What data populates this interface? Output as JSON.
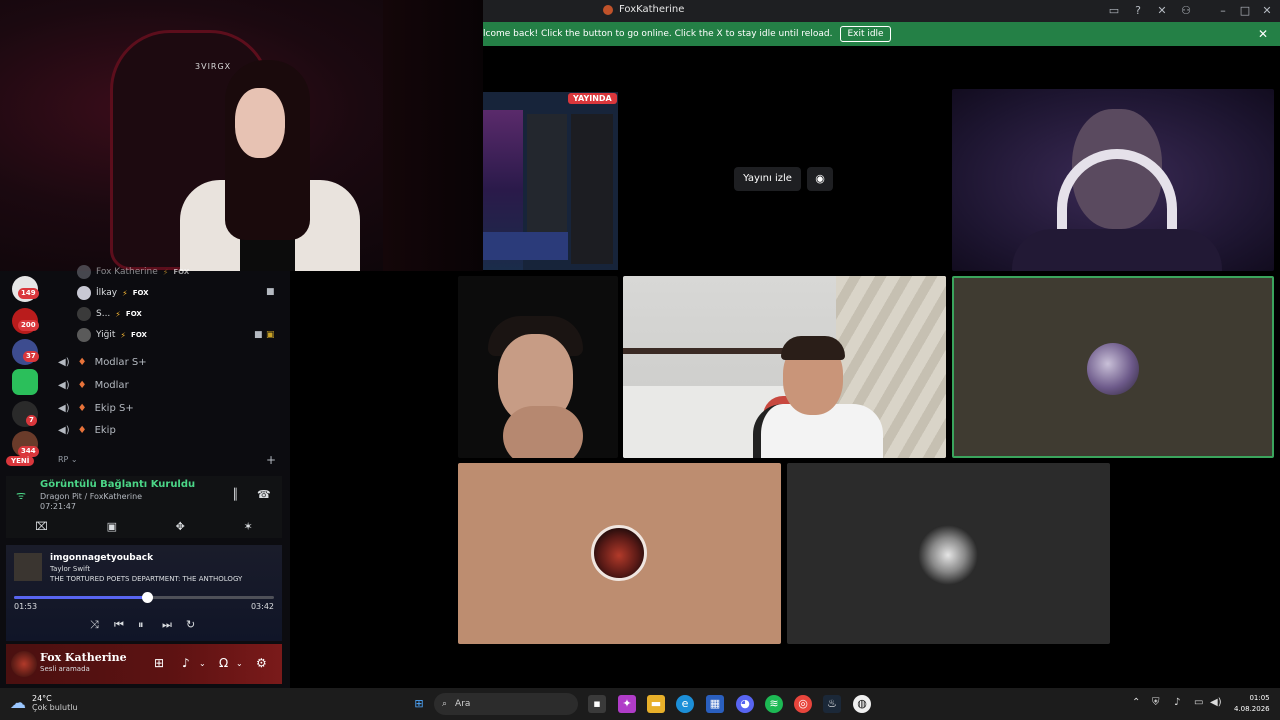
{
  "window": {
    "title": "FoxKatherine"
  },
  "notice": {
    "message": "lcome back! Click the button to go online. Click the X to stay idle until reload.",
    "button": "Exit idle",
    "close": "✕"
  },
  "streamer_overlay": {
    "chair_brand": "3VIRGX"
  },
  "stage": {
    "live_badge": "YAYINDA",
    "watch_button": "Yayını izle"
  },
  "sidebar": {
    "guild_badges": [
      "149",
      "200",
      "37",
      "7",
      "344"
    ],
    "new_badge": "YENİ",
    "voice_users": [
      {
        "name": "Fox Katherine",
        "tag": "FOX"
      },
      {
        "name": "İlkay",
        "tag": "FOX"
      },
      {
        "name": "S...",
        "tag": "FOX"
      },
      {
        "name": "Yiğit",
        "tag": "FOX"
      }
    ],
    "channels": [
      "Modlar S+",
      "Modlar",
      "Ekip S+",
      "Ekip"
    ],
    "category": "RP"
  },
  "voice_panel": {
    "status": "Görüntülü Bağlantı Kuruldu",
    "channel": "Dragon Pit / FoxKatherine",
    "elapsed": "07:21:47"
  },
  "music": {
    "song": "imgonnagetyouback",
    "artist": "Taylor Swift",
    "album": "THE TORTURED POETS DEPARTMENT: THE ANTHOLOGY",
    "current_time": "01:53",
    "total_time": "03:42",
    "progress": 0.51
  },
  "user": {
    "name": "Fox Katherine",
    "status": "Sesli aramada"
  },
  "taskbar": {
    "temperature": "24°C",
    "condition": "Çok bulutlu",
    "search_placeholder": "Ara",
    "time": "01:05",
    "date": "4.08.2026"
  },
  "colors": {
    "notice_green": "#248046",
    "speaking_border": "#3ba55d",
    "live_red": "#da373c",
    "accent": "#5865f2"
  }
}
